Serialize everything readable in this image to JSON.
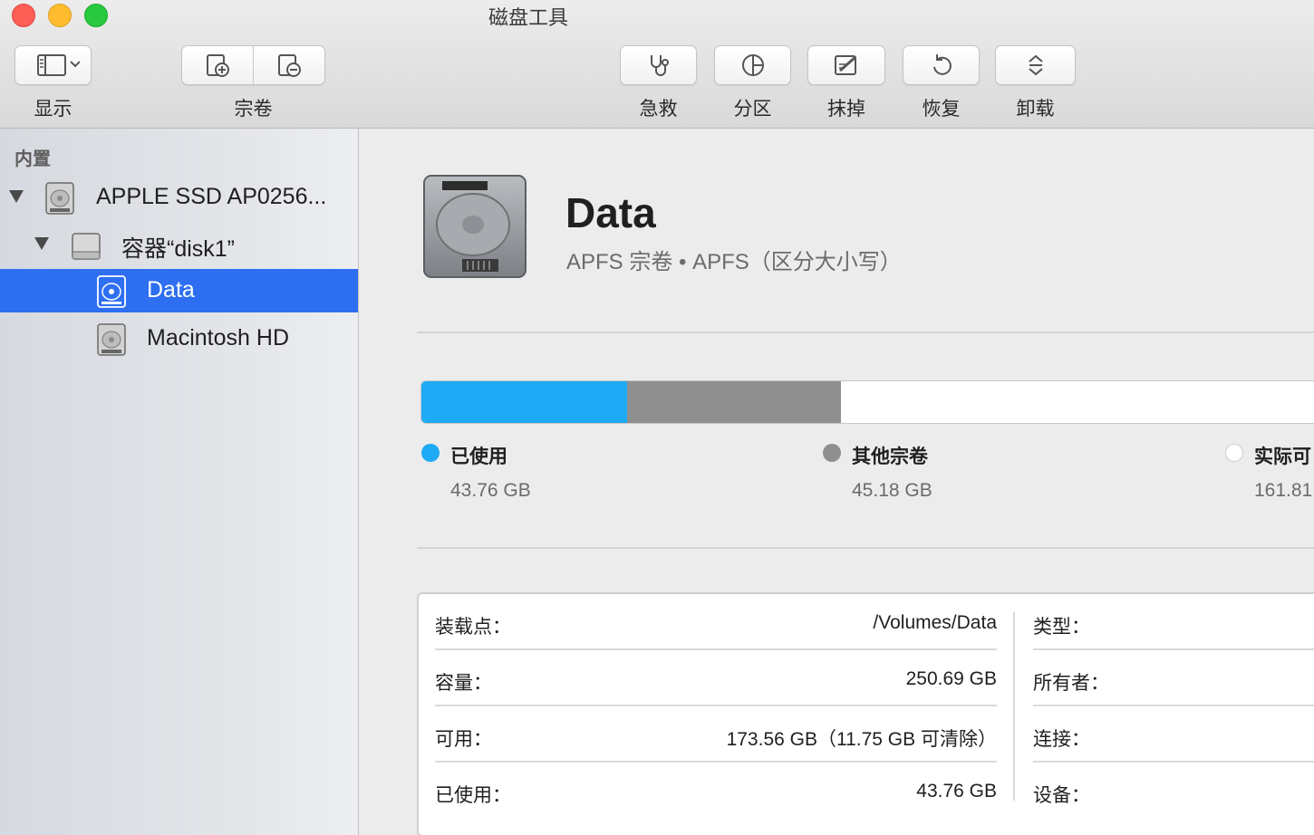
{
  "window": {
    "title": "磁盘工具"
  },
  "toolbar": {
    "view_label": "显示",
    "volume_label": "宗卷",
    "first_aid_label": "急救",
    "partition_label": "分区",
    "erase_label": "抹掉",
    "restore_label": "恢复",
    "unmount_label": "卸载"
  },
  "sidebar": {
    "section": "内置",
    "items": [
      {
        "label": "APPLE SSD AP0256...",
        "icon": "internal-disk-icon"
      },
      {
        "label": "容器“disk1”",
        "icon": "container-icon"
      },
      {
        "label": "Data",
        "icon": "volume-icon",
        "selected": true
      },
      {
        "label": "Macintosh HD",
        "icon": "volume-icon"
      }
    ]
  },
  "volume": {
    "name": "Data",
    "subtitle": "APFS 宗卷 • APFS（区分大小写）"
  },
  "usage": {
    "colors": {
      "used": "#1eaaf5",
      "other": "#8f8f8f",
      "free": "#ffffff"
    },
    "used": {
      "label": "已使用",
      "value": "43.76 GB"
    },
    "other": {
      "label": "其他宗卷",
      "value": "45.18 GB"
    },
    "free": {
      "label": "实际可",
      "value": "161.81"
    }
  },
  "info": {
    "mount_point": {
      "key": "装载点：",
      "value": "/Volumes/Data"
    },
    "capacity": {
      "key": "容量：",
      "value": "250.69 GB"
    },
    "available": {
      "key": "可用：",
      "value": "173.56 GB（11.75 GB 可清除）"
    },
    "used": {
      "key": "已使用：",
      "value": "43.76 GB"
    },
    "type": {
      "key": "类型："
    },
    "owners": {
      "key": "所有者："
    },
    "connection": {
      "key": "连接："
    },
    "device": {
      "key": "设备："
    }
  }
}
